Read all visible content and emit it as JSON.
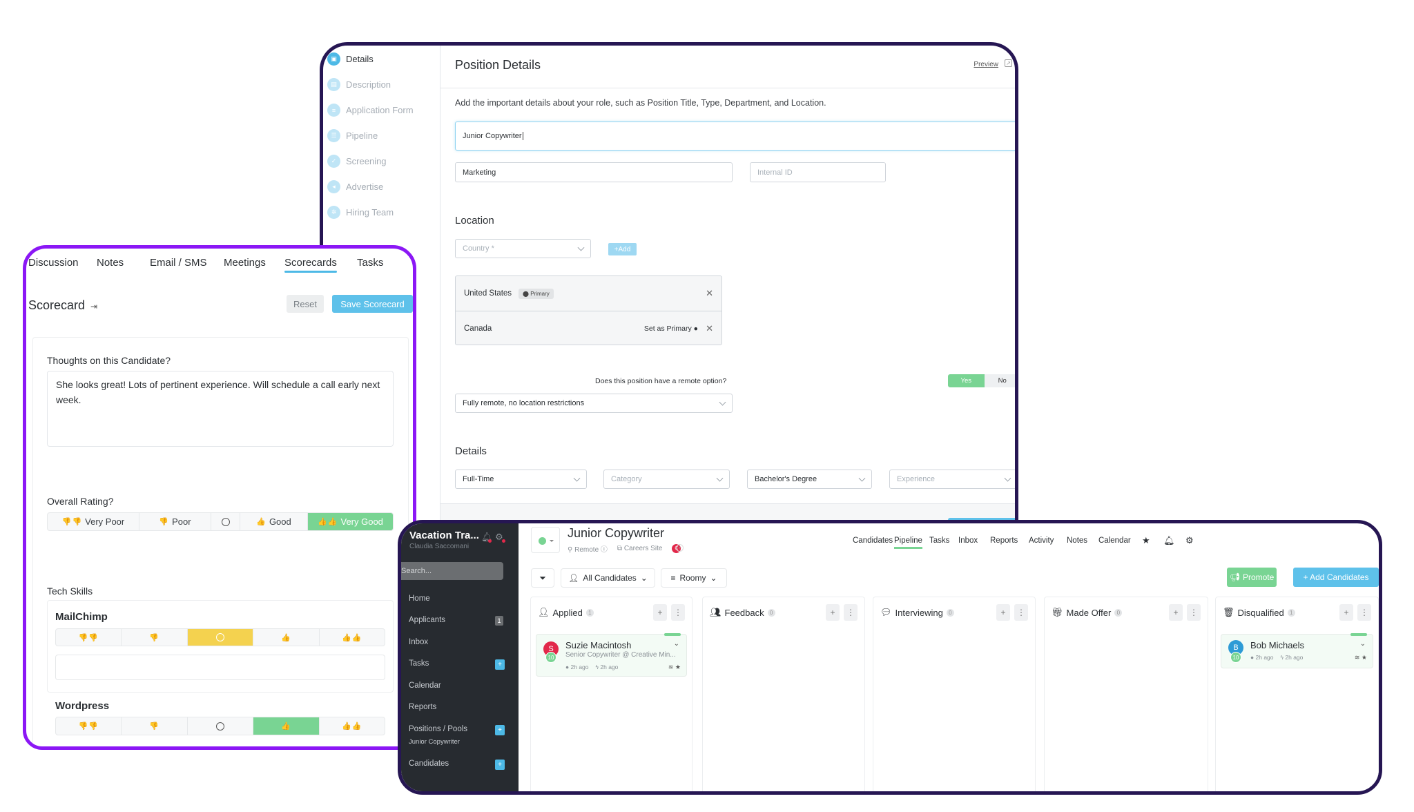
{
  "position_editor": {
    "steps": [
      {
        "label": "Details",
        "icon": "briefcase-icon",
        "active": true
      },
      {
        "label": "Description",
        "icon": "document-icon",
        "active": false
      },
      {
        "label": "Application Form",
        "icon": "form-icon",
        "active": false
      },
      {
        "label": "Pipeline",
        "icon": "list-icon",
        "active": false
      },
      {
        "label": "Screening",
        "icon": "thumbs-up-icon",
        "active": false
      },
      {
        "label": "Advertise",
        "icon": "megaphone-icon",
        "active": false
      },
      {
        "label": "Hiring Team",
        "icon": "team-icon",
        "active": false
      }
    ],
    "title": "Position Details",
    "preview_label": "Preview",
    "description": "Add the important details about your role, such as Position Title, Type, Department, and Location.",
    "position_title_value": "Junior Copywriter",
    "department_value": "Marketing",
    "internal_id_placeholder": "Internal ID",
    "location_heading": "Location",
    "country_placeholder": "Country *",
    "add_label": "+Add",
    "locations": [
      {
        "name": "United States",
        "badge": "Primary"
      },
      {
        "name": "Canada",
        "action": "Set as Primary"
      }
    ],
    "remote_question": "Does this position have a remote option?",
    "remote_yes": "Yes",
    "remote_no": "No",
    "remote_selected": "Yes",
    "remote_type_value": "Fully remote, no location restrictions",
    "details_heading": "Details",
    "employment_type_value": "Full-Time",
    "category_placeholder": "Category",
    "education_value": "Bachelor's Degree",
    "experience_placeholder": "Experience"
  },
  "scorecard_panel": {
    "tabs": [
      {
        "label": "Discussion",
        "active": false
      },
      {
        "label": "Notes",
        "active": false
      },
      {
        "label": "Email / SMS",
        "active": false
      },
      {
        "label": "Meetings",
        "active": false
      },
      {
        "label": "Scorecards",
        "active": true
      },
      {
        "label": "Tasks",
        "active": false
      }
    ],
    "title": "Scorecard",
    "reset_label": "Reset",
    "save_label": "Save Scorecard",
    "thoughts_label": "Thoughts on this Candidate?",
    "thoughts_value": "She looks great! Lots of pertinent experience. Will schedule a call early next week.",
    "overall_label": "Overall Rating?",
    "overall_options": [
      "Very Poor",
      "Poor",
      "",
      "Good",
      "Very Good"
    ],
    "overall_selected": "Very Good",
    "tech_skills_label": "Tech Skills",
    "skills": [
      {
        "name": "MailChimp",
        "selected_index": 2,
        "selected_color": "#f4d24f"
      },
      {
        "name": "Wordpress",
        "selected_index": 3,
        "selected_color": "#79d493"
      }
    ]
  },
  "pipeline_app": {
    "org_name": "Vacation Tra...",
    "user_name": "Claudia Saccomani",
    "search_placeholder": "Search...",
    "nav": [
      {
        "label": "Home"
      },
      {
        "label": "Applicants",
        "count": "1"
      },
      {
        "label": "Inbox"
      },
      {
        "label": "Tasks",
        "plus": true
      },
      {
        "label": "Calendar"
      },
      {
        "label": "Reports"
      },
      {
        "label": "Positions / Pools",
        "plus": true,
        "sub": "Junior Copywriter"
      },
      {
        "label": "Candidates",
        "plus": true
      }
    ],
    "position_title": "Junior Copywriter",
    "location_tag": "Remote",
    "careers_site_label": "Careers Site",
    "owner_initial": "C",
    "top_nav": [
      "Candidates",
      "Pipeline",
      "Tasks",
      "Inbox",
      "Reports",
      "Activity",
      "Notes",
      "Calendar"
    ],
    "top_nav_active": "Pipeline",
    "filter_all_candidates": "All Candidates",
    "filter_density": "Roomy",
    "promote_label": "Promote",
    "add_candidates_label": "+ Add Candidates",
    "stages": [
      {
        "name": "Applied",
        "count": "1",
        "icon": "user-icon",
        "candidates": [
          {
            "initial": "S",
            "name": "Suzie Macintosh",
            "headline": "Senior Copywriter @ Creative Min...",
            "score": "10",
            "avatar_color": "#e2284a",
            "applied": "2h ago",
            "activity": "2h ago"
          }
        ]
      },
      {
        "name": "Feedback",
        "count": "0",
        "icon": "users-icon",
        "candidates": []
      },
      {
        "name": "Interviewing",
        "count": "0",
        "icon": "comments-icon",
        "candidates": []
      },
      {
        "name": "Made Offer",
        "count": "0",
        "icon": "gift-icon",
        "candidates": []
      },
      {
        "name": "Disqualified",
        "count": "1",
        "icon": "trash-icon",
        "candidates": [
          {
            "initial": "B",
            "name": "Bob Michaels",
            "headline": "",
            "score": "10",
            "avatar_color": "#2e9bd6",
            "applied": "2h ago",
            "activity": "2h ago"
          }
        ]
      }
    ]
  },
  "colors": {
    "accent_blue": "#5ec1ea",
    "accent_green": "#79d493",
    "accent_yellow": "#f4d24f",
    "frame_navy": "#261653",
    "frame_purple": "#8b17f5",
    "sidebar_dark": "#272b30"
  }
}
